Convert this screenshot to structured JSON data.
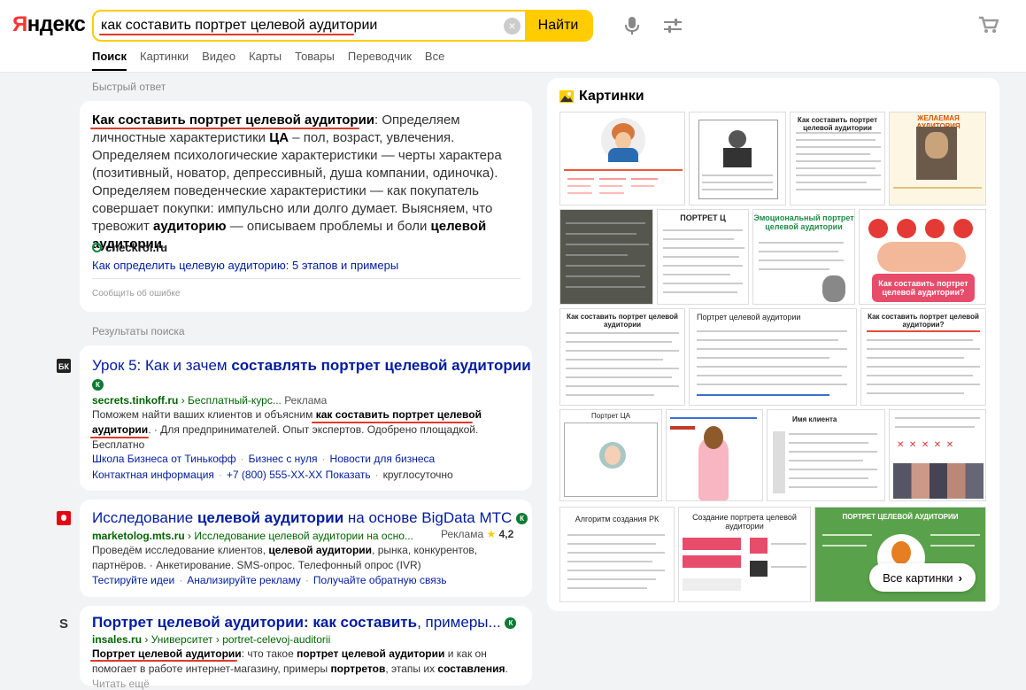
{
  "logo": {
    "text": "Яндекс"
  },
  "search": {
    "query": "как составить портрет целевой аудитории",
    "button": "Найти"
  },
  "tabs": [
    "Поиск",
    "Картинки",
    "Видео",
    "Карты",
    "Товары",
    "Переводчик",
    "Все"
  ],
  "quick_answer": {
    "label": "Быстрый ответ",
    "bold_lead": "Как составить портрет целевой аудитории",
    "text_1": ": Определяем личностные характеристики ",
    "bold_ca": "ЦА",
    "text_2": " – пол, возраст, увлечения. Определяем психологические характеристики — черты характера (позитивный, новатор, депрессивный, душа компании, одиночка). Определяем поведенческие характеристики — как покупатель совершает покупки: импульсно или долго думает. Выясняем, что тревожит ",
    "bold_aud": "аудиторию",
    "text_3": " — описываем проблемы и боли ",
    "bold_ca2": "целевой аудитории",
    "text_4": ".",
    "source": "checkroi.ru",
    "link": "Как определить целевую аудиторию: 5 этапов и примеры",
    "report": "Сообщить об ошибке"
  },
  "results_label": "Результаты поиска",
  "results": [
    {
      "icon": "bk-icon",
      "title_plain": "Урок 5: Как и зачем ",
      "title_bold": "составлять портрет целевой аудитории",
      "url_domain": "secrets.tinkoff.ru",
      "url_path": " › Бесплатный-курс...",
      "ad": "Реклама",
      "snippet_1": "Поможем найти ваших клиентов и объясним ",
      "snippet_bold": "как составить портрет целевой аудитории",
      "snippet_2": ". · Для предпринимателей. Опыт экспертов. Одобрено площадкой. Бесплатно",
      "sitelinks_1": [
        "Школа Бизнеса от Тинькофф",
        "Бизнес с нуля",
        "Новости для бизнеса"
      ],
      "sitelinks_2": [
        "Контактная информация",
        "+7 (800) 555-XX-XX Показать",
        "круглосуточно"
      ]
    },
    {
      "icon": "mts-icon",
      "title_plain": "Исследование ",
      "title_bold": "целевой аудитории",
      "title_plain_2": " на основе BigData МТС",
      "url_domain": "marketolog.mts.ru",
      "url_path": " › Исследование целевой аудитории на осно...",
      "ad": "Реклама",
      "rating": "4,2",
      "snippet_1": "Проведём исследование клиентов, ",
      "snippet_bold": "целевой аудитории",
      "snippet_2": ", рынка, конкурентов, партнёров. · Анкетирование. SMS-опрос. Телефонный опрос (IVR)",
      "sitelinks_1": [
        "Тестируйте идеи",
        "Анализируйте рекламу",
        "Получайте обратную связь"
      ]
    },
    {
      "icon": "insales-icon",
      "title_bold": "Портрет целевой аудитории: как составить",
      "title_plain": ", примеры...",
      "url_domain": "insales.ru",
      "url_path": " › Университет › portret-celevoj-auditorii",
      "snippet_bold": "Портрет целевой аудитории",
      "snippet_1": ": что такое ",
      "snippet_bold_2": "портрет целевой аудитории",
      "snippet_2": " и как он помогает в работе интернет-магазину, примеры ",
      "snippet_bold_3": "портретов",
      "snippet_3": ", этапы их ",
      "snippet_bold_4": "составления",
      "snippet_4": ".",
      "read_more": "Читать ещё"
    }
  ],
  "images": {
    "title": "Картинки",
    "all_button": "Все картинки",
    "captions": {
      "c4": "Как составить портрет целевой аудитории",
      "c5": "ЖЕЛАЕМАЯ АУДИТОРИЯ",
      "c7": "ПОРТРЕТ Ц",
      "c8": "Эмоциональный портрет целевой аудитории",
      "c9": "Как составить портрет целевой аудитории?",
      "c10": "Как составить портрет целевой аудитории",
      "c11": "Портрет целевой аудитории",
      "c12": "Как составить портрет целевой аудитории?",
      "c13": "Портрет ЦА",
      "c15": "Имя клиента",
      "c17": "Алгоритм создания РК",
      "c18": "Создание портрета целевой аудитории",
      "c19": "ПОРТРЕТ ЦЕЛЕВОЙ АУДИТОРИИ"
    }
  },
  "colors": {
    "accent": "#ffcc00",
    "link": "#001ba1",
    "url": "#006400",
    "underline": "#e0392b"
  }
}
